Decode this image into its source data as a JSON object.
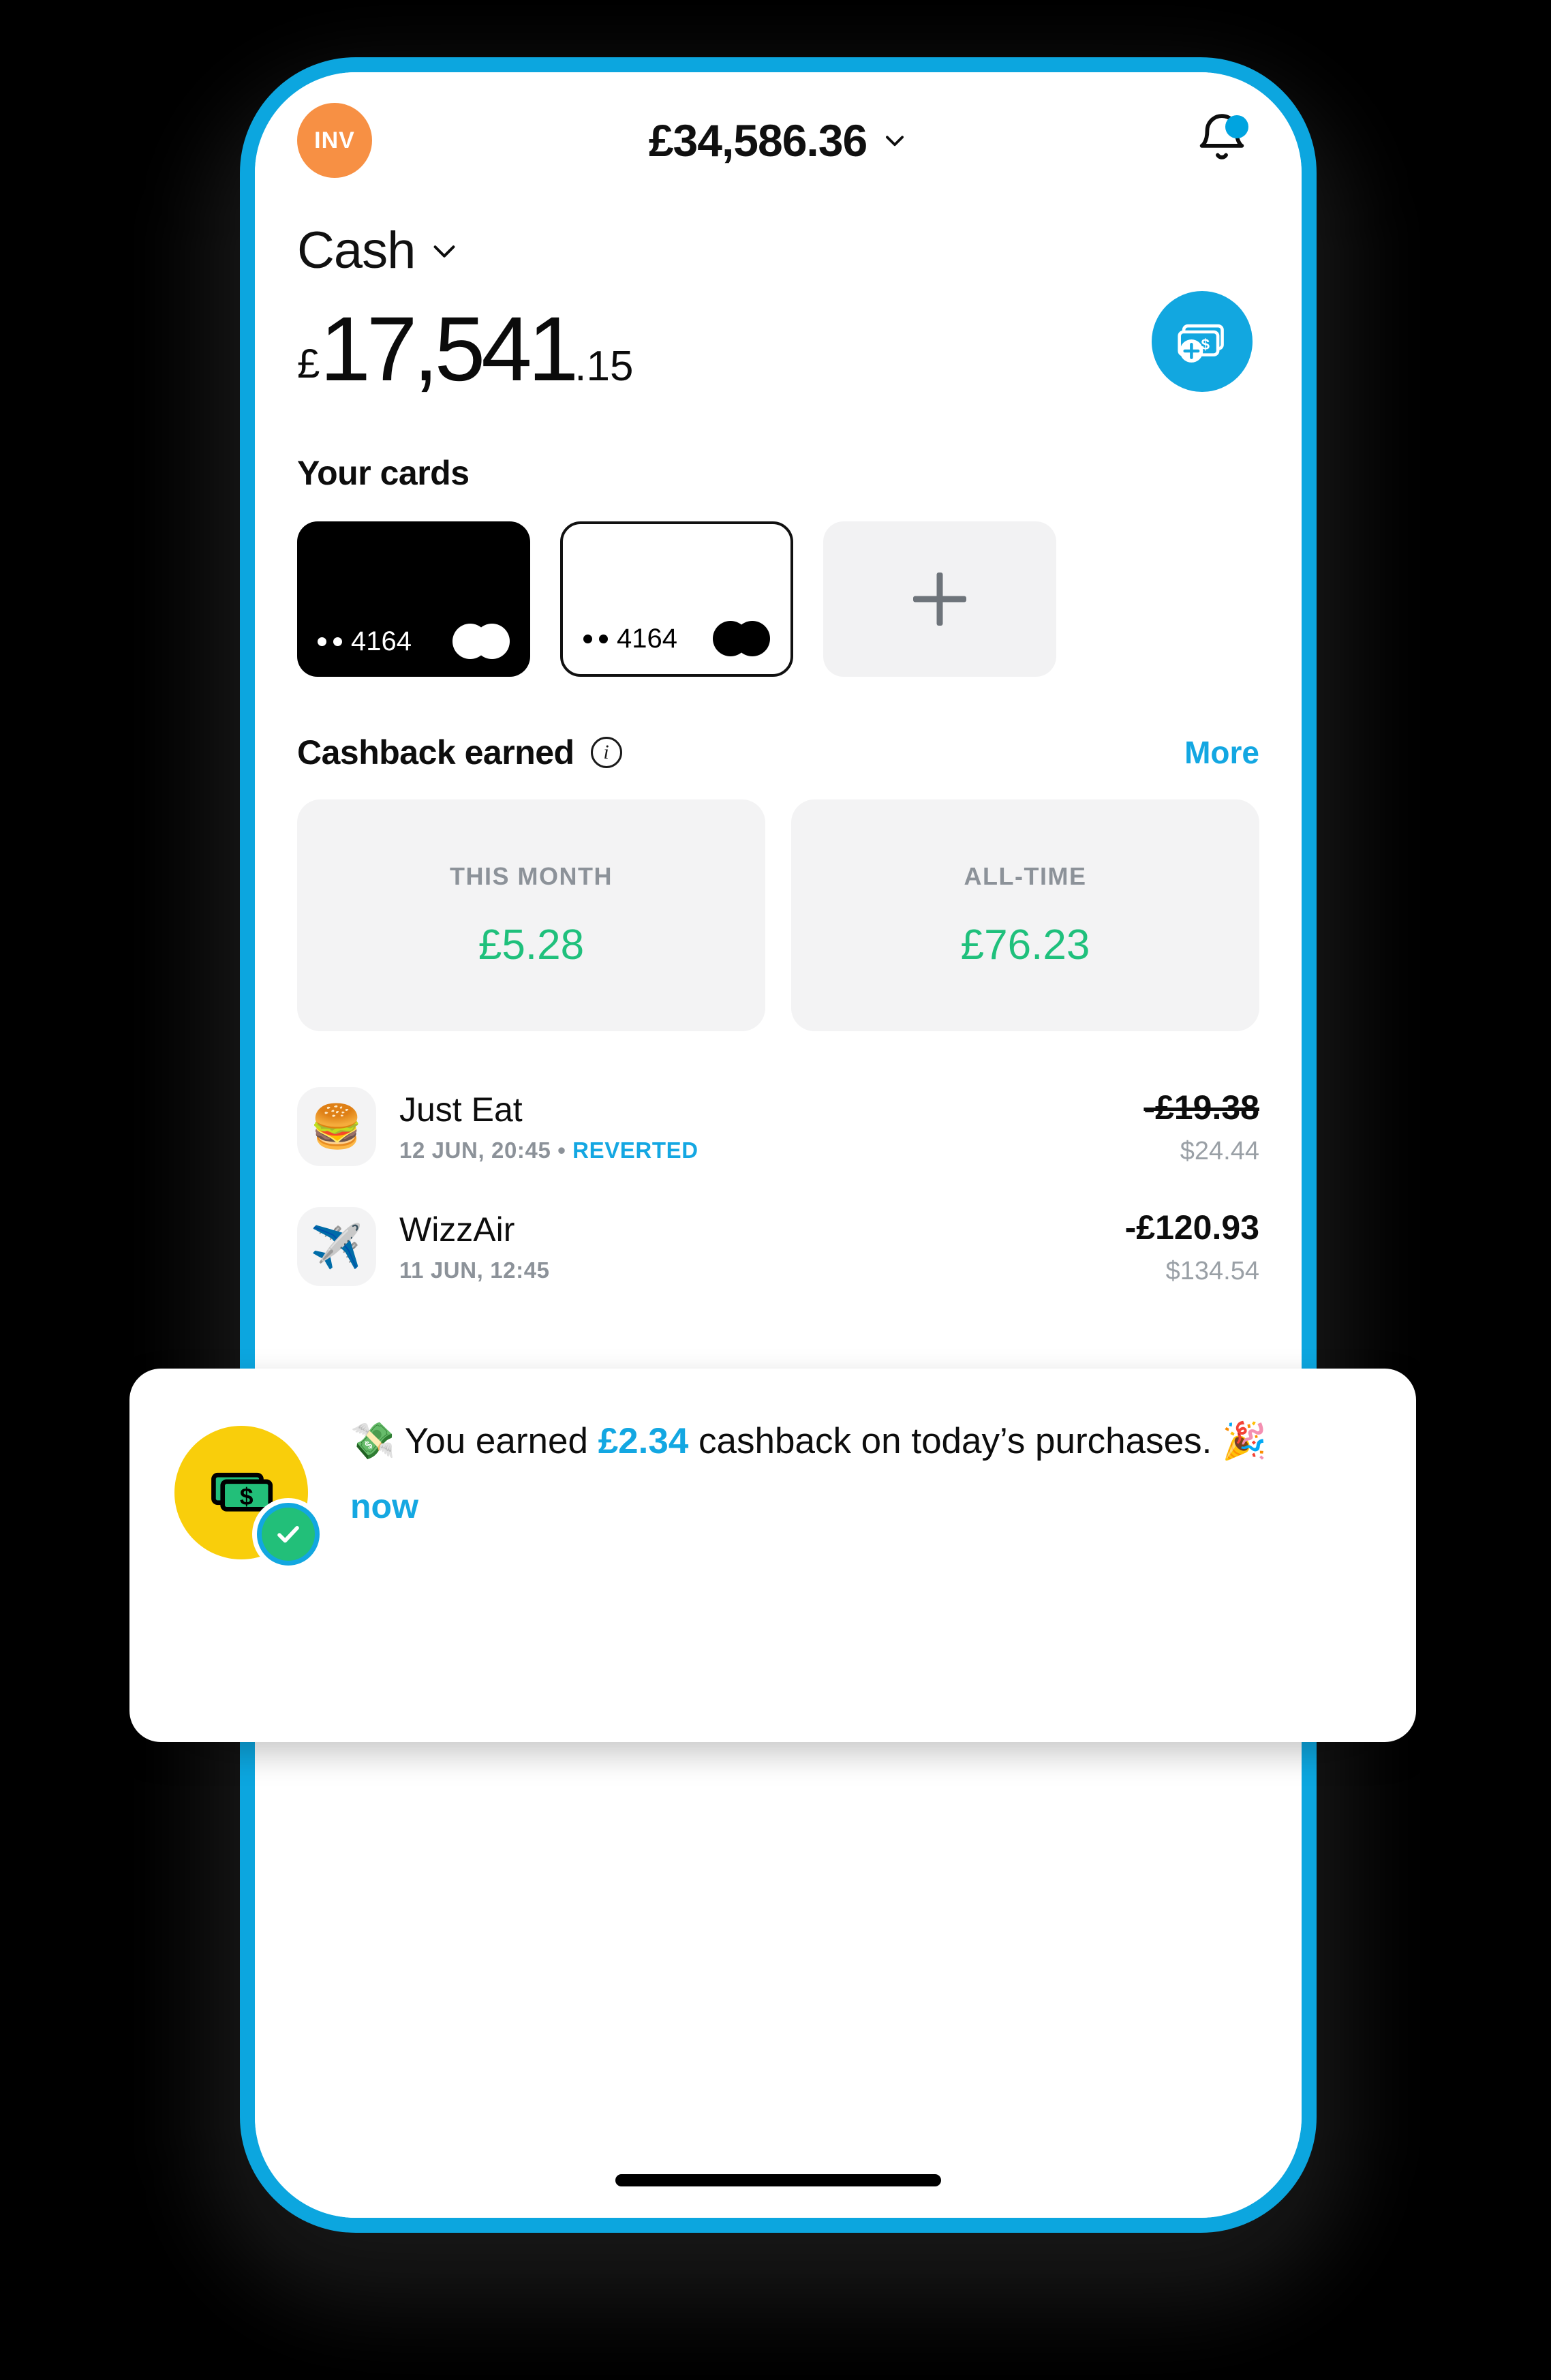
{
  "header": {
    "avatar_initials": "INV",
    "avatar_color": "#F79044",
    "total_balance": "£34,586.36",
    "chevron_icon": "chevron-down-icon",
    "bell_icon": "bell-icon",
    "bell_has_badge": true
  },
  "account": {
    "label": "Cash",
    "currency_symbol": "£",
    "amount_integer": "17,541",
    "amount_decimal": ".15",
    "add_money_icon": "add-money-icon"
  },
  "cards": {
    "title": "Your cards",
    "items": [
      {
        "masked": "4164",
        "dots": "••",
        "style": "dark",
        "network_icon": "mastercard-icon"
      },
      {
        "masked": "4164",
        "dots": "••",
        "style": "light",
        "network_icon": "mastercard-icon"
      }
    ],
    "add_card_icon": "plus-icon"
  },
  "cashback": {
    "title": "Cashback earned",
    "info_icon": "info-icon",
    "info_glyph": "i",
    "more_label": "More",
    "accent_color": "#1FC07C",
    "stats": [
      {
        "label": "THIS MONTH",
        "value": "£5.28"
      },
      {
        "label": "ALL-TIME",
        "value": "£76.23"
      }
    ]
  },
  "transactions": [
    {
      "icon": "hamburger-icon",
      "emoji": "🍔",
      "name": "Just Eat",
      "datetime": "12 JUN, 20:45",
      "separator": "•",
      "status": "REVERTED",
      "amount": "-£19.38",
      "amount_struck": true,
      "secondary_amount": "$24.44"
    },
    {
      "icon": "airplane-icon",
      "emoji": "✈️",
      "name": "WizzAir",
      "datetime": "11 JUN, 12:45",
      "separator": "",
      "status": "",
      "amount": "-£120.93",
      "amount_struck": false,
      "secondary_amount": "$134.54"
    }
  ],
  "toast": {
    "icon": "money-cashback-icon",
    "badge_icon": "check-icon",
    "text_before": "💸 You earned ",
    "amount": "£2.34",
    "text_after": " cashback on today’s purchases. 🎉",
    "time": "now",
    "accent_color": "#13A7E2"
  },
  "device": {
    "frame_color": "#0CA6DF",
    "home_indicator": "home-indicator"
  }
}
